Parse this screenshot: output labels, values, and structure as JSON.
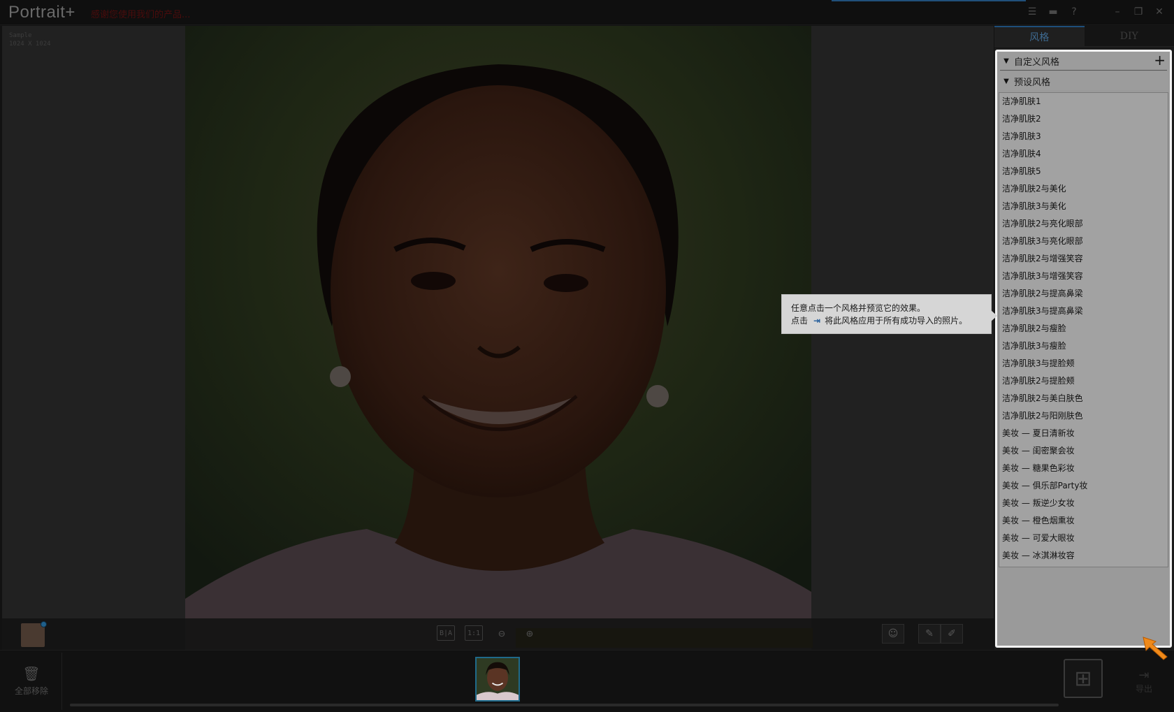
{
  "titlebar": {
    "app_name": "Portrait+",
    "subtitle": "感谢您使用我们的产品...",
    "icons": [
      "list-icon",
      "comment-icon",
      "help-icon",
      "minimize-icon",
      "restore-icon",
      "close-icon"
    ]
  },
  "image": {
    "name": "Sample",
    "size": "1024 X 1024"
  },
  "canvas_tools": {
    "compare_label": "B|A",
    "fit_label": "1:1",
    "zoom_out": "zoom-out-icon",
    "zoom_in": "zoom-in-icon"
  },
  "panel": {
    "tabs": [
      {
        "label": "风格",
        "active": true
      },
      {
        "label": "DIY",
        "active": false
      }
    ],
    "custom_section": "自定义风格",
    "preset_section": "预设风格",
    "presets": [
      "洁净肌肤1",
      "洁净肌肤2",
      "洁净肌肤3",
      "洁净肌肤4",
      "洁净肌肤5",
      "洁净肌肤2与美化",
      "洁净肌肤3与美化",
      "洁净肌肤2与亮化眼部",
      "洁净肌肤3与亮化眼部",
      "洁净肌肤2与增强笑容",
      "洁净肌肤3与增强笑容",
      "洁净肌肤2与提高鼻梁",
      "洁净肌肤3与提高鼻梁",
      "洁净肌肤2与瘦脸",
      "洁净肌肤3与瘦脸",
      "洁净肌肤3与提脸颊",
      "洁净肌肤2与提脸颊",
      "洁净肌肤2与美白肤色",
      "洁净肌肤2与阳刚肤色",
      "美妆 — 夏日清新妆",
      "美妆 — 闺密聚会妆",
      "美妆 — 糖果色彩妆",
      "美妆 — 俱乐部Party妆",
      "美妆 — 叛逆少女妆",
      "美妆 — 橙色烟熏妆",
      "美妆 — 可爱大眼妆",
      "美妆 — 冰淇淋妆容"
    ]
  },
  "tooltip": {
    "line1": "任意点击一个风格并预览它的效果。",
    "line2_prefix": "点击",
    "line2_suffix": "将此风格应用于所有成功导入的照片。"
  },
  "filmstrip": {
    "remove_all": "全部移除",
    "export": "导出"
  }
}
